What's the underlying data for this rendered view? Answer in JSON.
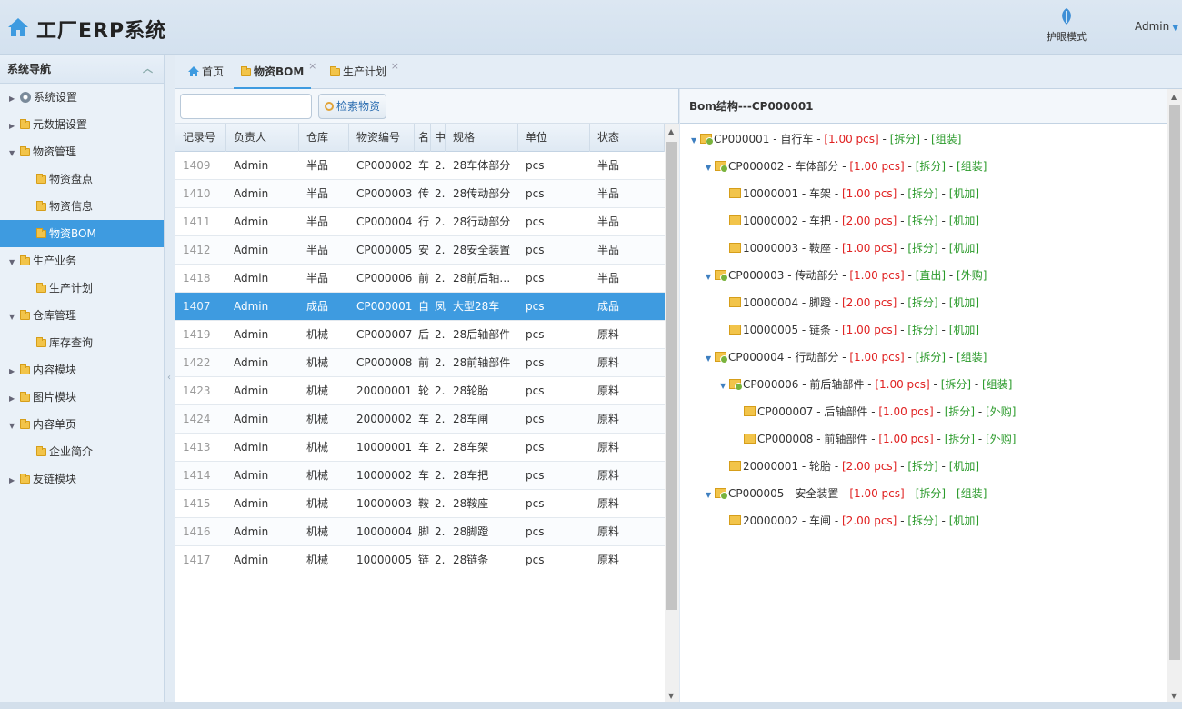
{
  "header": {
    "title": "工厂ERP系统",
    "eye_mode": "护眼模式",
    "user": "Admin"
  },
  "sidebar": {
    "title": "系统导航",
    "items": [
      {
        "label": "系统设置",
        "level": 1,
        "expanded": false
      },
      {
        "label": "元数据设置",
        "level": 1,
        "expanded": false
      },
      {
        "label": "物资管理",
        "level": 1,
        "expanded": true
      },
      {
        "label": "物资盘点",
        "level": 2
      },
      {
        "label": "物资信息",
        "level": 2
      },
      {
        "label": "物资BOM",
        "level": 2,
        "active": true
      },
      {
        "label": "生产业务",
        "level": 1,
        "expanded": true
      },
      {
        "label": "生产计划",
        "level": 2
      },
      {
        "label": "仓库管理",
        "level": 1,
        "expanded": true
      },
      {
        "label": "库存查询",
        "level": 2
      },
      {
        "label": "内容模块",
        "level": 1,
        "expanded": false
      },
      {
        "label": "图片模块",
        "level": 1,
        "expanded": false
      },
      {
        "label": "内容单页",
        "level": 1,
        "expanded": true
      },
      {
        "label": "企业简介",
        "level": 2
      },
      {
        "label": "友链模块",
        "level": 1,
        "expanded": false
      }
    ]
  },
  "tabs": [
    {
      "label": "首页",
      "closable": false
    },
    {
      "label": "物资BOM",
      "closable": true,
      "active": true
    },
    {
      "label": "生产计划",
      "closable": true
    }
  ],
  "search": {
    "placeholder": "",
    "button": "检索物资"
  },
  "grid": {
    "columns": [
      "记录号",
      "负责人",
      "仓库",
      "物资编号",
      "名",
      "中",
      "规格",
      "单位",
      "状态"
    ],
    "rows": [
      [
        "1409",
        "Admin",
        "半品",
        "CP000002",
        "车",
        "2.",
        "28车体部分",
        "pcs",
        "半品"
      ],
      [
        "1410",
        "Admin",
        "半品",
        "CP000003",
        "传",
        "2.",
        "28传动部分",
        "pcs",
        "半品"
      ],
      [
        "1411",
        "Admin",
        "半品",
        "CP000004",
        "行",
        "2.",
        "28行动部分",
        "pcs",
        "半品"
      ],
      [
        "1412",
        "Admin",
        "半品",
        "CP000005",
        "安",
        "2.",
        "28安全装置",
        "pcs",
        "半品"
      ],
      [
        "1418",
        "Admin",
        "半品",
        "CP000006",
        "前",
        "2.",
        "28前后轴…",
        "pcs",
        "半品"
      ],
      [
        "1407",
        "Admin",
        "成品",
        "CP000001",
        "自",
        "凤",
        "大型28车",
        "pcs",
        "成品"
      ],
      [
        "1419",
        "Admin",
        "机械",
        "CP000007",
        "后",
        "2.",
        "28后轴部件",
        "pcs",
        "原料"
      ],
      [
        "1422",
        "Admin",
        "机械",
        "CP000008",
        "前",
        "2.",
        "28前轴部件",
        "pcs",
        "原料"
      ],
      [
        "1423",
        "Admin",
        "机械",
        "20000001",
        "轮",
        "2.",
        "28轮胎",
        "pcs",
        "原料"
      ],
      [
        "1424",
        "Admin",
        "机械",
        "20000002",
        "车",
        "2.",
        "28车闸",
        "pcs",
        "原料"
      ],
      [
        "1413",
        "Admin",
        "机械",
        "10000001",
        "车",
        "2.",
        "28车架",
        "pcs",
        "原料"
      ],
      [
        "1414",
        "Admin",
        "机械",
        "10000002",
        "车",
        "2.",
        "28车把",
        "pcs",
        "原料"
      ],
      [
        "1415",
        "Admin",
        "机械",
        "10000003",
        "鞍",
        "2.",
        "28鞍座",
        "pcs",
        "原料"
      ],
      [
        "1416",
        "Admin",
        "机械",
        "10000004",
        "脚",
        "2.",
        "28脚蹬",
        "pcs",
        "原料"
      ],
      [
        "1417",
        "Admin",
        "机械",
        "10000005",
        "链",
        "2.",
        "28链条",
        "pcs",
        "原料"
      ]
    ],
    "selected_index": 5
  },
  "bom": {
    "title": "Bom结构---CP000001",
    "nodes": [
      {
        "depth": 0,
        "expandable": true,
        "name": "CP000001 - 自行车 - ",
        "qty": "[1.00 pcs]",
        "sep1": " - ",
        "op1": "[拆分]",
        "sep2": " - ",
        "op2": "[组装]"
      },
      {
        "depth": 1,
        "expandable": true,
        "name": "CP000002 - 车体部分 - ",
        "qty": "[1.00 pcs]",
        "sep1": " - ",
        "op1": "[拆分]",
        "sep2": " - ",
        "op2": "[组装]"
      },
      {
        "depth": 2,
        "expandable": false,
        "name": "10000001 - 车架 - ",
        "qty": "[1.00 pcs]",
        "sep1": " - ",
        "op1": "[拆分]",
        "sep2": " - ",
        "op2": "[机加]"
      },
      {
        "depth": 2,
        "expandable": false,
        "name": "10000002 - 车把 - ",
        "qty": "[2.00 pcs]",
        "sep1": " - ",
        "op1": "[拆分]",
        "sep2": " - ",
        "op2": "[机加]"
      },
      {
        "depth": 2,
        "expandable": false,
        "name": "10000003 - 鞍座 - ",
        "qty": "[1.00 pcs]",
        "sep1": " - ",
        "op1": "[拆分]",
        "sep2": " - ",
        "op2": "[机加]"
      },
      {
        "depth": 1,
        "expandable": true,
        "name": "CP000003 - 传动部分 - ",
        "qty": "[1.00 pcs]",
        "sep1": " - ",
        "op1": "[直出]",
        "sep2": " - ",
        "op2": "[外购]"
      },
      {
        "depth": 2,
        "expandable": false,
        "name": "10000004 - 脚蹬 - ",
        "qty": "[2.00 pcs]",
        "sep1": " - ",
        "op1": "[拆分]",
        "sep2": " - ",
        "op2": "[机加]"
      },
      {
        "depth": 2,
        "expandable": false,
        "name": "10000005 - 链条 - ",
        "qty": "[1.00 pcs]",
        "sep1": " - ",
        "op1": "[拆分]",
        "sep2": " - ",
        "op2": "[机加]"
      },
      {
        "depth": 1,
        "expandable": true,
        "name": "CP000004 - 行动部分 - ",
        "qty": "[1.00 pcs]",
        "sep1": " - ",
        "op1": "[拆分]",
        "sep2": " - ",
        "op2": "[组装]"
      },
      {
        "depth": 2,
        "expandable": true,
        "name": "CP000006 - 前后轴部件 - ",
        "qty": "[1.00 pcs]",
        "sep1": " - ",
        "op1": "[拆分]",
        "sep2": " - ",
        "op2": "[组装]"
      },
      {
        "depth": 3,
        "expandable": false,
        "name": "CP000007 - 后轴部件 - ",
        "qty": "[1.00 pcs]",
        "sep1": " - ",
        "op1": "[拆分]",
        "sep2": " - ",
        "op2": "[外购]"
      },
      {
        "depth": 3,
        "expandable": false,
        "name": "CP000008 - 前轴部件 - ",
        "qty": "[1.00 pcs]",
        "sep1": " - ",
        "op1": "[拆分]",
        "sep2": " - ",
        "op2": "[外购]"
      },
      {
        "depth": 2,
        "expandable": false,
        "name": "20000001 - 轮胎 - ",
        "qty": "[2.00 pcs]",
        "sep1": " - ",
        "op1": "[拆分]",
        "sep2": " - ",
        "op2": "[机加]"
      },
      {
        "depth": 1,
        "expandable": true,
        "name": "CP000005 - 安全装置 - ",
        "qty": "[1.00 pcs]",
        "sep1": " - ",
        "op1": "[拆分]",
        "sep2": " - ",
        "op2": "[组装]"
      },
      {
        "depth": 2,
        "expandable": false,
        "name": "20000002 - 车闸 - ",
        "qty": "[2.00 pcs]",
        "sep1": " - ",
        "op1": "[拆分]",
        "sep2": " - ",
        "op2": "[机加]"
      }
    ]
  },
  "colors": {
    "accent": "#3e9be0",
    "qty": "#e02020",
    "op": "#2a9a2a"
  }
}
